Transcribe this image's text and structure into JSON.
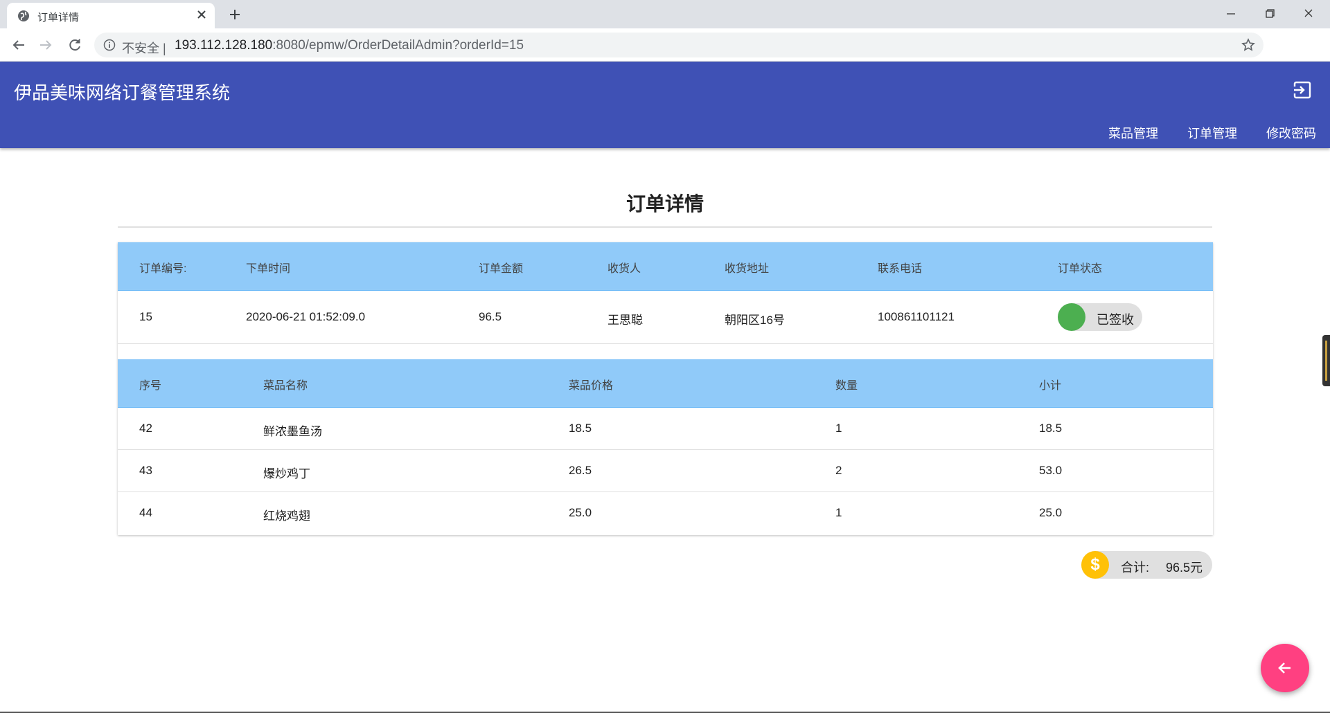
{
  "browser": {
    "tab_title": "订单详情",
    "insecure_label": "不安全 |",
    "url_host": "193.112.128.180",
    "url_rest": ":8080/epmw/OrderDetailAdmin?orderId=15"
  },
  "header": {
    "title": "伊品美味网络订餐管理系统",
    "nav": [
      "菜品管理",
      "订单管理",
      "修改密码"
    ]
  },
  "page": {
    "title": "订单详情"
  },
  "order": {
    "columns": [
      "订单编号:",
      "下单时间",
      "订单金额",
      "收货人",
      "收货地址",
      "联系电话",
      "订单状态"
    ],
    "row": {
      "id": "15",
      "time": "2020-06-21 01:52:09.0",
      "amount": "96.5",
      "receiver": "王思聪",
      "address": "朝阳区16号",
      "phone": "100861101121",
      "status": "已签收"
    }
  },
  "items": {
    "columns": [
      "序号",
      "菜品名称",
      "菜品价格",
      "数量",
      "小计"
    ],
    "rows": [
      [
        "42",
        "鲜浓墨鱼汤",
        "18.5",
        "1",
        "18.5"
      ],
      [
        "43",
        "爆炒鸡丁",
        "26.5",
        "2",
        "53.0"
      ],
      [
        "44",
        "红烧鸡翅",
        "25.0",
        "1",
        "25.0"
      ]
    ]
  },
  "total": {
    "coin_symbol": "$",
    "label": "合计:",
    "value": "96.5元"
  },
  "colors": {
    "primary": "#3f51b5",
    "table_header": "#90caf9",
    "status_green": "#4caf50",
    "coin_amber": "#ffc107",
    "fab_pink": "#ff4081"
  },
  "icons": [
    "globe-icon",
    "close-icon",
    "plus-icon",
    "back-arrow-icon",
    "forward-arrow-icon",
    "reload-icon",
    "info-icon",
    "star-icon",
    "account-icon",
    "more-vert-icon",
    "logout-icon",
    "arrow-left-icon"
  ]
}
